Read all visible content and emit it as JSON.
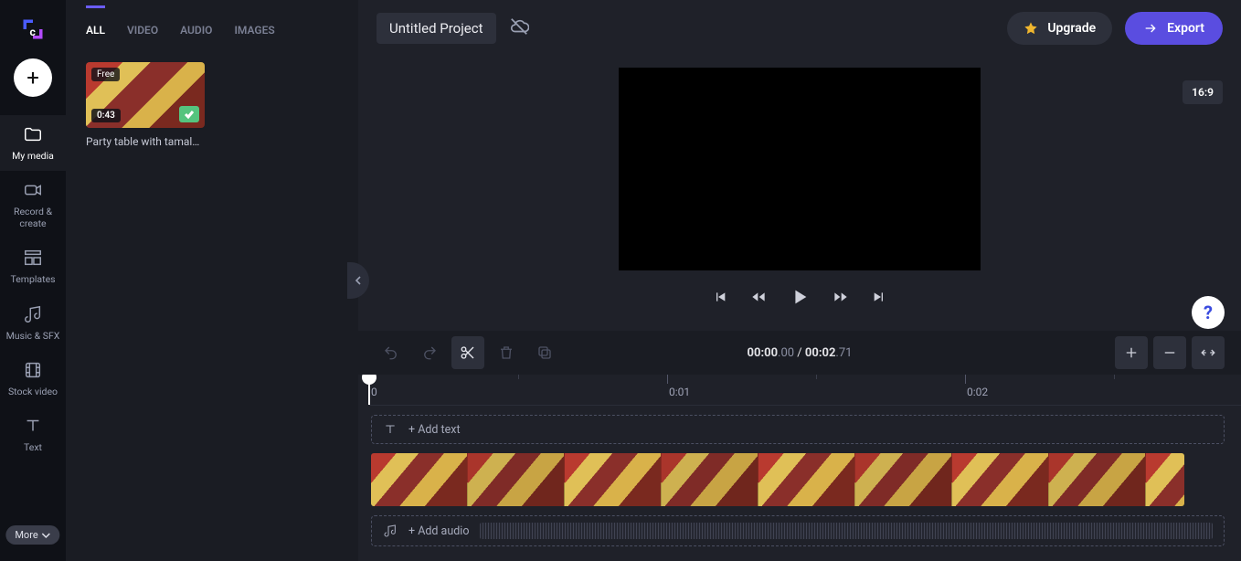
{
  "brand": {
    "logo_char": "c"
  },
  "sidebar": {
    "add_label": "+",
    "items": [
      {
        "label": "My media"
      },
      {
        "label": "Record & create"
      },
      {
        "label": "Templates"
      },
      {
        "label": "Music & SFX"
      },
      {
        "label": "Stock video"
      },
      {
        "label": "Text"
      }
    ],
    "more_label": "More"
  },
  "panel": {
    "tabs": [
      {
        "label": "ALL",
        "active": true
      },
      {
        "label": "VIDEO"
      },
      {
        "label": "AUDIO"
      },
      {
        "label": "IMAGES"
      }
    ],
    "media": [
      {
        "free_badge": "Free",
        "duration": "0:43",
        "title": "Party table with tamal…"
      }
    ]
  },
  "header": {
    "project_title": "Untitled Project",
    "upgrade_label": "Upgrade",
    "export_label": "Export",
    "aspect_ratio": "16:9"
  },
  "transport": {
    "current": "00:00",
    "current_frac": ".00",
    "sep": " / ",
    "total": "00:02",
    "total_frac": ".71"
  },
  "ruler": {
    "marks": [
      "0",
      "0:01",
      "0:02"
    ]
  },
  "tracks": {
    "text_placeholder": "+ Add text",
    "audio_placeholder": "+ Add audio",
    "clip_frames": 9
  },
  "help": {
    "glyph": "?"
  }
}
